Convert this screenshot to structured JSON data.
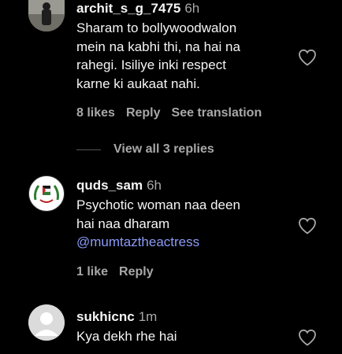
{
  "comments": [
    {
      "username": "archit_s_g_7475",
      "time": "6h",
      "text_lines": [
        "Sharam to bollywoodwalon",
        "mein na kabhi thi, na hai na",
        "rahegi. Isiliye inki respect",
        "karne ki aukaat nahi."
      ],
      "likes": "8 likes",
      "reply": "Reply",
      "translation": "See translation",
      "view_replies": "View all 3 replies"
    },
    {
      "username": "quds_sam",
      "time": "6h",
      "text_lines": [
        "Psychotic woman naa deen",
        "hai naa dharam"
      ],
      "mention": "@mumtaztheactress",
      "likes": "1 like",
      "reply": "Reply"
    },
    {
      "username": "sukhicnc",
      "time": "1m",
      "text_lines": [
        "Kya dekh rhe hai"
      ]
    }
  ],
  "colors": {
    "background": "#000000",
    "text": "#f5f5f5",
    "muted": "#a8a8a8",
    "mention": "#8b9bf6"
  }
}
